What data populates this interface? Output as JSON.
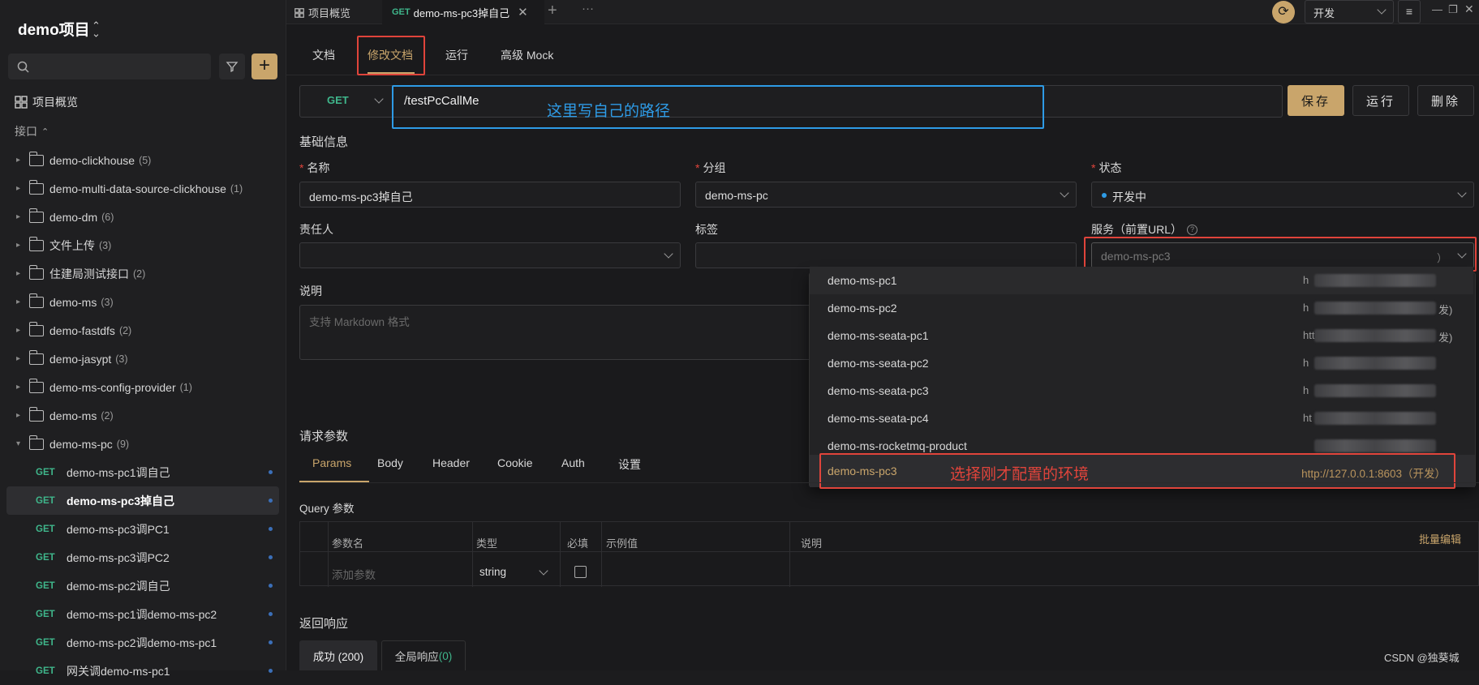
{
  "project": {
    "title": "demo项目",
    "switch_icon": "updown-chevron-icon"
  },
  "search": {
    "placeholder": ""
  },
  "sidebar": {
    "overview_label": "项目概览",
    "section_label": "接口",
    "folders": [
      {
        "name": "demo-clickhouse",
        "count": "(5)"
      },
      {
        "name": "demo-multi-data-source-clickhouse",
        "count": "(1)"
      },
      {
        "name": "demo-dm",
        "count": "(6)"
      },
      {
        "name": "文件上传",
        "count": "(3)"
      },
      {
        "name": "住建局测试接口",
        "count": "(2)"
      },
      {
        "name": "demo-ms",
        "count": "(3)"
      },
      {
        "name": "demo-fastdfs",
        "count": "(2)"
      },
      {
        "name": "demo-jasypt",
        "count": "(3)"
      },
      {
        "name": "demo-ms-config-provider",
        "count": "(1)"
      },
      {
        "name": "demo-ms",
        "count": "(2)"
      },
      {
        "name": "demo-ms-pc",
        "count": "(9)"
      }
    ],
    "apis": [
      {
        "method": "GET",
        "name": "demo-ms-pc1调自己"
      },
      {
        "method": "GET",
        "name": "demo-ms-pc3掉自己"
      },
      {
        "method": "GET",
        "name": "demo-ms-pc3调PC1"
      },
      {
        "method": "GET",
        "name": "demo-ms-pc3调PC2"
      },
      {
        "method": "GET",
        "name": "demo-ms-pc2调自己"
      },
      {
        "method": "GET",
        "name": "demo-ms-pc1调demo-ms-pc2"
      },
      {
        "method": "GET",
        "name": "demo-ms-pc2调demo-ms-pc1"
      },
      {
        "method": "GET",
        "name": "网关调demo-ms-pc1"
      }
    ]
  },
  "topbar": {
    "tab_overview": "项目概览",
    "tab_active_method": "GET",
    "tab_active_name": "demo-ms-pc3掉自己",
    "env_select": "开发"
  },
  "doc_tabs": [
    "文档",
    "修改文档",
    "运行",
    "高级 Mock"
  ],
  "request": {
    "method": "GET",
    "path": "/testPcCallMe",
    "annotation": "这里写自己的路径",
    "save": "保存",
    "run": "运行",
    "delete": "删除"
  },
  "basic": {
    "section": "基础信息",
    "name_label": "名称",
    "name_value": "demo-ms-pc3掉自己",
    "group_label": "分组",
    "group_value": "demo-ms-pc",
    "status_label": "状态",
    "status_value": "开发中",
    "owner_label": "责任人",
    "tags_label": "标签",
    "service_label": "服务（前置URL）",
    "service_value": "demo-ms-pc3",
    "service_suffix": "）",
    "desc_label": "说明",
    "desc_placeholder": "支持 Markdown 格式"
  },
  "dropdown": {
    "items": [
      {
        "name": "demo-ms-pc1",
        "url_tail": ""
      },
      {
        "name": "demo-ms-pc2",
        "url_tail": "发)"
      },
      {
        "name": "demo-ms-seata-pc1",
        "url_tail": "发)"
      },
      {
        "name": "demo-ms-seata-pc2",
        "url_tail": ""
      },
      {
        "name": "demo-ms-seata-pc3",
        "url_tail": ""
      },
      {
        "name": "demo-ms-seata-pc4",
        "url_tail": ""
      },
      {
        "name": "demo-ms-rocketmq-product",
        "url_tail": ""
      }
    ],
    "url_heads": [
      "h",
      "h",
      "htt",
      "h",
      "h",
      "ht",
      ""
    ],
    "selected": {
      "name": "demo-ms-pc3",
      "url": "http://127.0.0.1:8603（开发）"
    },
    "annotation": "选择刚才配置的环境"
  },
  "params": {
    "section": "请求参数",
    "tabs": [
      "Params",
      "Body",
      "Header",
      "Cookie",
      "Auth",
      "设置"
    ],
    "query_label": "Query 参数",
    "headers": [
      "参数名",
      "类型",
      "必填",
      "示例值",
      "说明"
    ],
    "bulk_edit": "批量编辑",
    "add_placeholder": "添加参数",
    "type_value": "string"
  },
  "response": {
    "section": "返回响应",
    "tab_success": "成功 (200)",
    "tab_global": "全局响应",
    "tab_global_count": "(0)"
  },
  "watermark": "CSDN @独葵城",
  "colors": {
    "accent": "#c9a56b",
    "get": "#3fb68b",
    "annotation_red": "#e0443b",
    "annotation_blue": "#2e9be6"
  }
}
